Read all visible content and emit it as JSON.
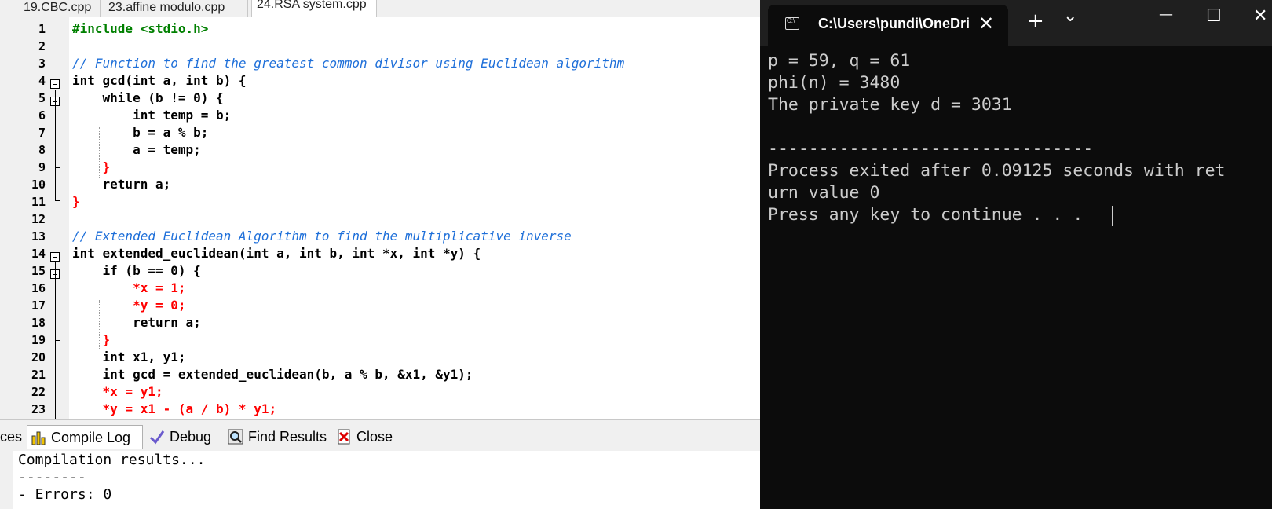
{
  "ide": {
    "tabs": [
      {
        "label": "19.CBC.cpp"
      },
      {
        "label": "23.affine modulo.cpp"
      },
      {
        "label": "24.RSA system.cpp"
      }
    ],
    "line_numbers": [
      "1",
      "2",
      "3",
      "4",
      "5",
      "6",
      "7",
      "8",
      "9",
      "10",
      "11",
      "12",
      "13",
      "14",
      "15",
      "16",
      "17",
      "18",
      "19",
      "20",
      "21",
      "22",
      "23"
    ],
    "code_lines": [
      "#include <stdio.h>",
      "",
      "// Function to find the greatest common divisor using Euclidean algorithm",
      "int gcd(int a, int b) {",
      "    while (b != 0) {",
      "        int temp = b;",
      "        b = a % b;",
      "        a = temp;",
      "    }",
      "    return a;",
      "}",
      "",
      "// Extended Euclidean Algorithm to find the multiplicative inverse",
      "int extended_euclidean(int a, int b, int *x, int *y) {",
      "    if (b == 0) {",
      "        *x = 1;",
      "        *y = 0;",
      "        return a;",
      "    }",
      "    int x1, y1;",
      "    int gcd = extended_euclidean(b, a % b, &x1, &y1);",
      "    *x = y1;",
      "    *y = x1 - (a / b) * y1;"
    ],
    "bottom_tabs": [
      {
        "label": "ces"
      },
      {
        "label": "Compile Log"
      },
      {
        "label": "Debug"
      },
      {
        "label": "Find Results"
      },
      {
        "label": "Close"
      }
    ],
    "log_lines": [
      "Compilation results...",
      "--------",
      "- Errors: 0"
    ]
  },
  "terminal": {
    "tab_title": "C:\\Users\\pundi\\OneDri",
    "close_glyph": "✕",
    "new_tab_glyph": "+",
    "dropdown_glyph": "⌄",
    "minimize_glyph": "—",
    "maximize_glyph": "☐",
    "window_close_glyph": "✕",
    "lines": [
      "p = 59, q = 61",
      "phi(n) = 3480",
      "The private key d = 3031",
      "",
      "--------------------------------",
      "Process exited after 0.09125 seconds with ret",
      "urn value 0",
      "Press any key to continue . . . "
    ]
  },
  "colors": {
    "keyword": "#000000",
    "preprocessor": "#008000",
    "comment": "#1e6fd9",
    "number": "#8000ff",
    "symbol": "#ff0000",
    "terminal_bg": "#0c0c0c",
    "terminal_fg": "#cccccc"
  }
}
